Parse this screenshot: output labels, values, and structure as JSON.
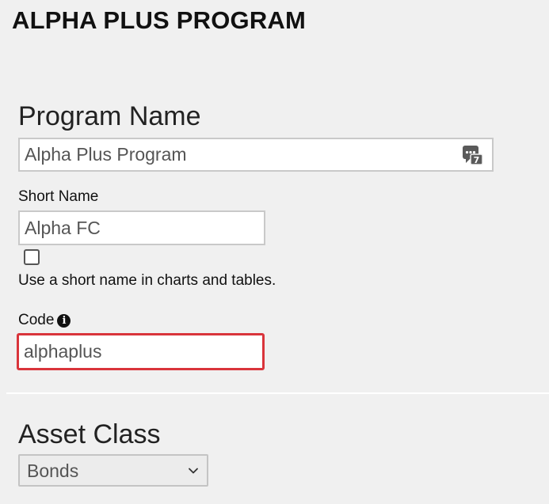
{
  "page": {
    "title": "ALPHA PLUS PROGRAM"
  },
  "program_name": {
    "heading": "Program Name",
    "value": "Alpha Plus Program",
    "translate_badge": "7",
    "translate_icon": "translate-icon"
  },
  "short_name": {
    "label": "Short Name",
    "value": "Alpha FC",
    "checkbox_checked": false,
    "help_text": "Use a short name in charts and tables."
  },
  "code": {
    "label": "Code",
    "value": "alphaplus",
    "info_icon": "info-icon",
    "info_glyph": "i",
    "error_color": "#d9343b"
  },
  "asset_class": {
    "heading": "Asset Class",
    "selected": "Bonds",
    "chevron_icon": "chevron-down-icon"
  }
}
